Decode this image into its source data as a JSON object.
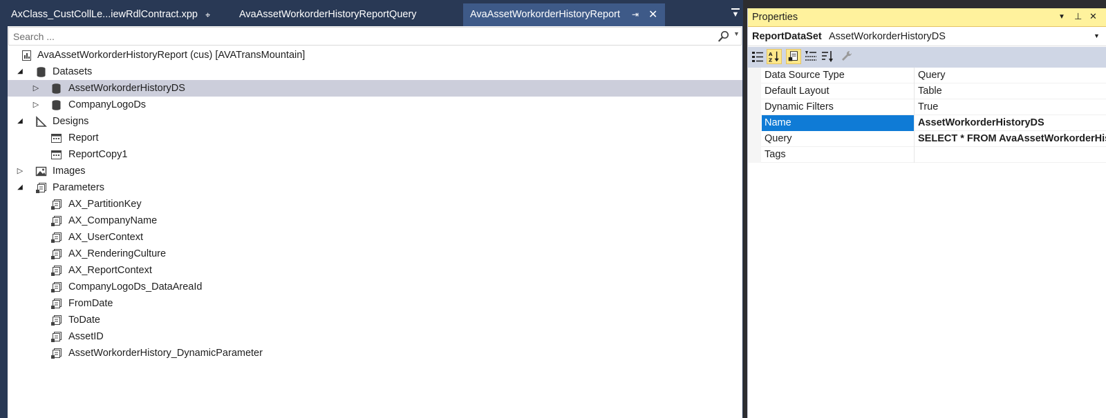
{
  "tabs": [
    {
      "label": "AxClass_CustCollLe...iewRdlContract.xpp",
      "pin": "⌖"
    },
    {
      "label": "AvaAssetWorkorderHistoryReportQuery"
    },
    {
      "label": "AvaAssetWorkorderHistoryReport",
      "pin": "⇥",
      "close": "✕",
      "active": true
    }
  ],
  "tab_overflow": "▼",
  "search": {
    "placeholder": "Search ...",
    "value": ""
  },
  "tree": {
    "root": "AvaAssetWorkorderHistoryReport (cus) [AVATransMountain]",
    "datasets": {
      "label": "Datasets",
      "items": [
        "AssetWorkorderHistoryDS",
        "CompanyLogoDs"
      ]
    },
    "designs": {
      "label": "Designs",
      "items": [
        "Report",
        "ReportCopy1"
      ]
    },
    "images": {
      "label": "Images"
    },
    "parameters": {
      "label": "Parameters",
      "items": [
        "AX_PartitionKey",
        "AX_CompanyName",
        "AX_UserContext",
        "AX_RenderingCulture",
        "AX_ReportContext",
        "CompanyLogoDs_DataAreaId",
        "FromDate",
        "ToDate",
        "AssetID",
        "AssetWorkorderHistory_DynamicParameter"
      ]
    }
  },
  "properties": {
    "title": "Properties",
    "object_type": "ReportDataSet",
    "object_name": "AssetWorkorderHistoryDS",
    "rows": [
      {
        "name": "Data Source Type",
        "value": "Query"
      },
      {
        "name": "Default Layout",
        "value": "Table"
      },
      {
        "name": "Dynamic Filters",
        "value": "True"
      },
      {
        "name": "Name",
        "value": "AssetWorkorderHistoryDS"
      },
      {
        "name": "Query",
        "value": "SELECT * FROM AvaAssetWorkorderHistoryReportQuery"
      },
      {
        "name": "Tags",
        "value": ""
      }
    ]
  },
  "colors": {
    "chrome": "#293955",
    "active_tab": "#3e5a88",
    "properties_title": "#fff29d",
    "selection": "#cccedb",
    "grid_selection": "#0f7bd6"
  }
}
